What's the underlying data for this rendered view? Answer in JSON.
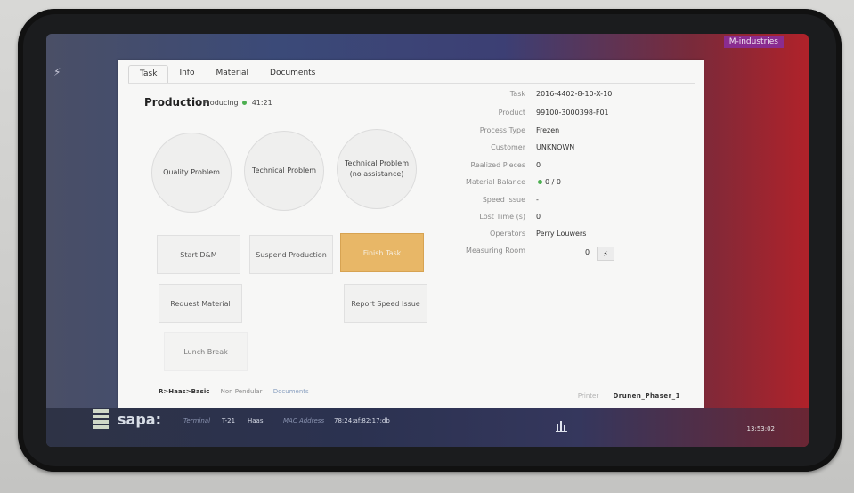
{
  "brand_badge": "M-industries",
  "tabs": [
    {
      "label": "Task",
      "active": true
    },
    {
      "label": "Info",
      "active": false
    },
    {
      "label": "Material",
      "active": false
    },
    {
      "label": "Documents",
      "active": false
    }
  ],
  "production": {
    "title": "Production",
    "status": "Producing",
    "elapsed": "41:21",
    "status_color": "#4caf50"
  },
  "problem_buttons": [
    {
      "label": "Quality Problem"
    },
    {
      "label": "Technical Problem"
    },
    {
      "label_line1": "Technical Problem",
      "label_line2": "(no assistance)"
    }
  ],
  "action_buttons": {
    "start_dm": "Start D&M",
    "suspend": "Suspend Production",
    "finish": "Finish Task",
    "request_material": "Request Material",
    "report_speed": "Report Speed Issue",
    "lunch_break": "Lunch Break"
  },
  "info": [
    {
      "label": "Task",
      "value": "2016-4402-8-10-X-10"
    },
    {
      "label": "Product",
      "value": "99100-3000398-F01"
    },
    {
      "label": "Process Type",
      "value": "Frezen"
    },
    {
      "label": "Customer",
      "value": "UNKNOWN"
    },
    {
      "label": "Realized Pieces",
      "value": "0"
    },
    {
      "label": "Material Balance",
      "value": "0 / 0"
    },
    {
      "label": "Speed Issue",
      "value": "-"
    },
    {
      "label": "Lost Time (s)",
      "value": "0"
    },
    {
      "label": "Operators",
      "value": "Perry Louwers"
    },
    {
      "label": "Measuring Room",
      "value": "0"
    }
  ],
  "measuring_button_icon": "lightning-icon",
  "footer": {
    "path": "R>Haas>Basic",
    "mode": "Non Pendular",
    "documents": "Documents",
    "printer_label": "Printer",
    "printer_value": "Drunen_Phaser_1"
  },
  "taskbar": {
    "logo": "sapa:",
    "terminal_label": "Terminal",
    "terminal_value": "T-21",
    "machine": "Haas",
    "mac_label": "MAC Address",
    "mac_value": "78:24:af:82:17:db",
    "time": "13:53:02"
  }
}
